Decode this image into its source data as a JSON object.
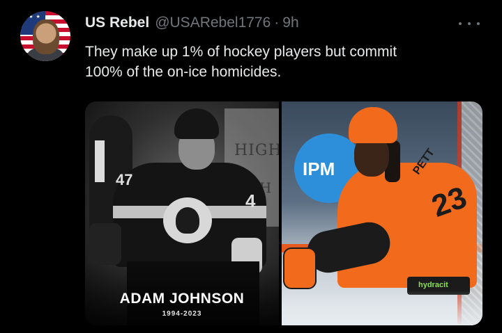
{
  "tweet": {
    "author_name": "US Rebel",
    "author_handle": "@USARebel1776",
    "separator": "·",
    "timestamp": "9h",
    "text": "They make up 1% of hockey players but commit\n100% of the on-ice homicides."
  },
  "media": {
    "left_photo": {
      "caption_name": "ADAM JOHNSON",
      "caption_years": "1994-2023",
      "jersey_numbers": [
        "47",
        "4"
      ],
      "background_sign": [
        "HIGH",
        "IGH"
      ]
    },
    "right_photo": {
      "logo_text": "IPM",
      "jersey_number": "23",
      "jersey_name": "PETT",
      "sponsor_text": "hydracit"
    }
  },
  "icons": {
    "more": "more-horizontal-icon",
    "avatar": "profile-avatar"
  },
  "colors": {
    "background": "#000000",
    "primary_text": "#e7e9ea",
    "secondary_text": "#71767b",
    "accent_orange": "#f26a1b"
  }
}
